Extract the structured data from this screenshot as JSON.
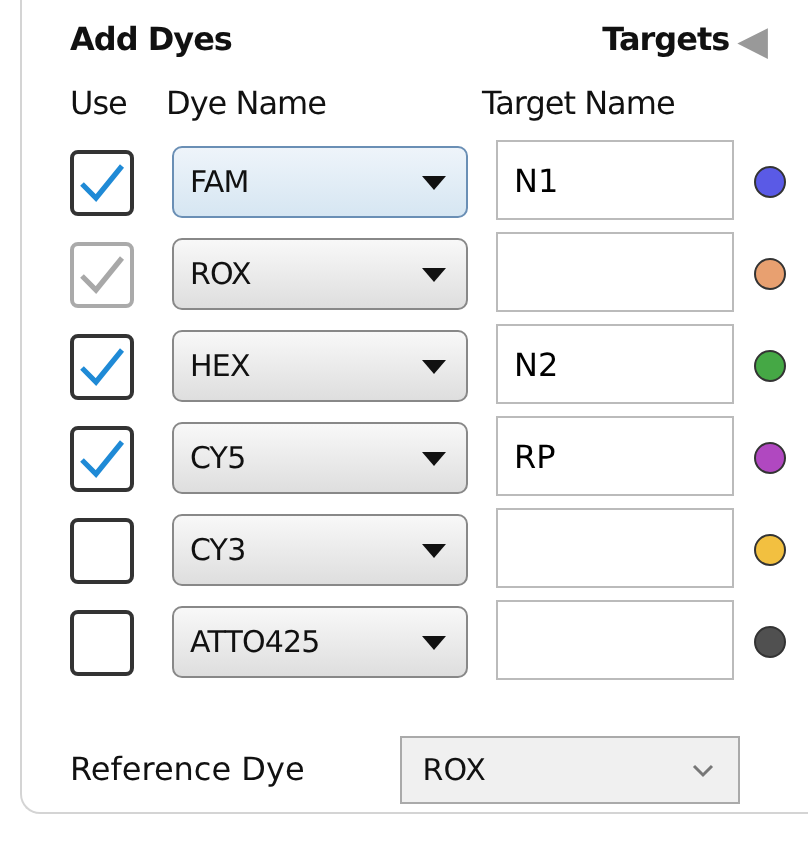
{
  "header": {
    "title": "Add Dyes",
    "targets_label": "Targets",
    "collapse_arrow": "◀"
  },
  "columns": [
    "Use",
    "Dye Name",
    "Target Name"
  ],
  "dyes": [
    {
      "checked": true,
      "disabled": false,
      "dye": "FAM",
      "target": "N1",
      "color": "#5a5ae6"
    },
    {
      "checked": true,
      "disabled": true,
      "dye": "ROX",
      "color": "#e8a070"
    },
    {
      "checked": true,
      "disabled": false,
      "dye": "HEX",
      "target": "N2",
      "color": "#45a845"
    },
    {
      "checked": true,
      "disabled": false,
      "dye": "CY5",
      "target": "RP",
      "color": "#b048c0"
    },
    {
      "checked": false,
      "disabled": false,
      "dye": "CY3",
      "color": "#f2c040"
    },
    {
      "checked": false,
      "disabled": false,
      "dye": "ATTO425",
      "color": "#505050"
    }
  ],
  "reference": {
    "label": "Reference Dye",
    "value": "ROX"
  }
}
